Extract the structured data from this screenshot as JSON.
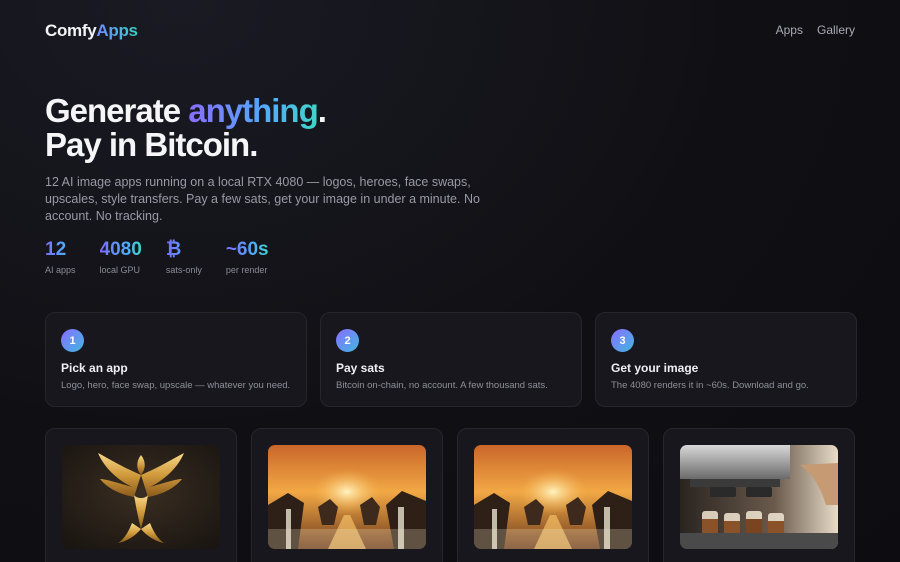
{
  "nav": {
    "brand_part1": "Comfy",
    "brand_part2": "Apps",
    "links": [
      "Apps",
      "Gallery"
    ]
  },
  "hero": {
    "title_line1_prefix": "Generate ",
    "title_line1_highlight": "anything",
    "title_line1_suffix": ".",
    "title_line2": "Pay in Bitcoin.",
    "subtitle": "12 AI image apps running on a local RTX 4080 — logos, heroes, face swaps, upscales, style transfers. Pay a few sats, get your image in under a minute. No account. No tracking."
  },
  "stats": [
    {
      "value": "12",
      "label": "AI apps"
    },
    {
      "value": "4080",
      "label": "local GPU"
    },
    {
      "value": "₿",
      "label": "sats-only"
    },
    {
      "value": "~60s",
      "label": "per render"
    }
  ],
  "steps": [
    {
      "num": "1",
      "title": "Pick an app",
      "desc": "Logo, hero, face swap, upscale — whatever you need."
    },
    {
      "num": "2",
      "title": "Pay sats",
      "desc": "Bitcoin on-chain, no account. A few thousand sats."
    },
    {
      "num": "3",
      "title": "Get your image",
      "desc": "The 4080 renders it in ~60s. Download and go."
    }
  ],
  "gallery": [
    {
      "image": "golden-phoenix-logo"
    },
    {
      "image": "waterfall-sunset"
    },
    {
      "image": "waterfall-sunset"
    },
    {
      "image": "espresso-machine-coffee"
    }
  ],
  "colors": {
    "background": "#101014",
    "card": "#17171d",
    "accent_purple": "#8a6cff",
    "accent_blue": "#55a6ff",
    "accent_teal": "#3fd5c8"
  }
}
